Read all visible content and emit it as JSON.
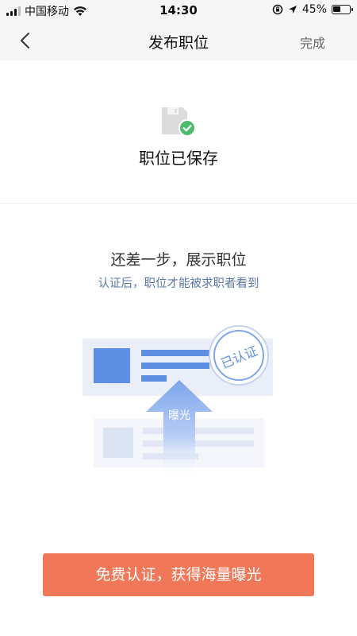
{
  "status_bar": {
    "carrier": "中国移动",
    "time": "14:30",
    "battery": "45%",
    "battery_level": 0.45,
    "icons": [
      "signal-icon",
      "wifi-icon",
      "orientation-lock-icon",
      "location-icon",
      "battery-icon"
    ]
  },
  "nav": {
    "title": "发布职位",
    "done": "完成",
    "back_icon": "chevron-left-icon"
  },
  "saved": {
    "icon": "saved-document-check-icon",
    "text": "职位已保存"
  },
  "promo": {
    "title": "还差一步，展示职位",
    "subtitle": "认证后，职位才能被求职者看到",
    "arrow_label": "曝光",
    "badge_label": "已认证"
  },
  "cta": {
    "label": "免费认证，获得海量曝光"
  },
  "colors": {
    "accent": "#f07758",
    "blue": "#5f8fe3",
    "subtitle": "#5b78a7",
    "check_green": "#4cbb6c"
  }
}
